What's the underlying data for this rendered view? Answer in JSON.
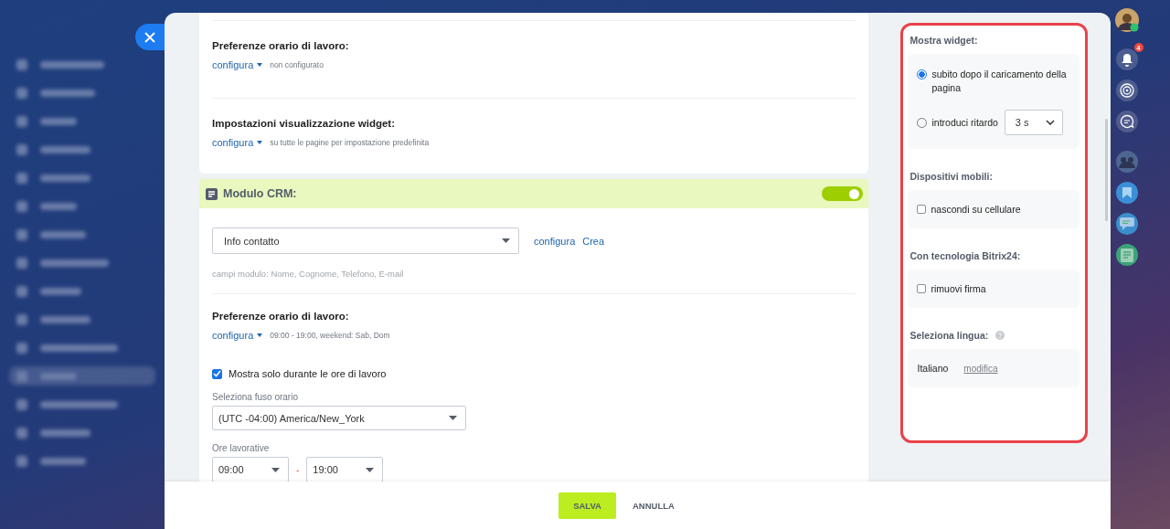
{
  "sections_top": [
    {
      "title": "Preferenze orario di lavoro:",
      "link": "configura",
      "note": "non configurato"
    },
    {
      "title": "Impostazioni visualizzazione widget:",
      "link": "configura",
      "note": "su tutte le pagine per impostazione predefinita"
    }
  ],
  "crm_form": {
    "title": "Modulo CRM:",
    "on": true,
    "form_select": "Info contatto",
    "links": [
      "configura",
      "Crea"
    ],
    "fields_note": "campi modulo: Nome, Cognome, Telefono, E-mail",
    "hours_title": "Preferenze orario di lavoro:",
    "hours_link": "configura",
    "hours_note": "09:00 - 19:00, weekend: Sab, Dom",
    "only_work_hours": {
      "label": "Mostra solo durante le ore di lavoro",
      "checked": true
    },
    "timezone_label": "Seleziona fuso orario",
    "timezone": "(UTC -04:00) America/New_York",
    "hours_label": "Ore lavorative",
    "from": "09:00",
    "separator": "-",
    "to": "19:00"
  },
  "footer": {
    "save": "SALVA",
    "cancel": "ANNULLA"
  },
  "side_settings": {
    "show_widget": {
      "title": "Mostra widget:",
      "options": [
        {
          "label": "subito dopo il caricamento della pagina",
          "selected": true
        },
        {
          "label": "introduci ritardo",
          "selected": false,
          "delay": "3 s"
        }
      ]
    },
    "mobile": {
      "title": "Dispositivi mobili:",
      "label": "nascondi su cellulare",
      "checked": false
    },
    "branding": {
      "title": "Con tecnologia Bitrix24:",
      "label": "rimuovi firma",
      "checked": false
    },
    "language": {
      "title": "Seleziona lingua:",
      "value": "Italiano",
      "link": "modifica"
    }
  },
  "notifications": {
    "badge": "4"
  }
}
